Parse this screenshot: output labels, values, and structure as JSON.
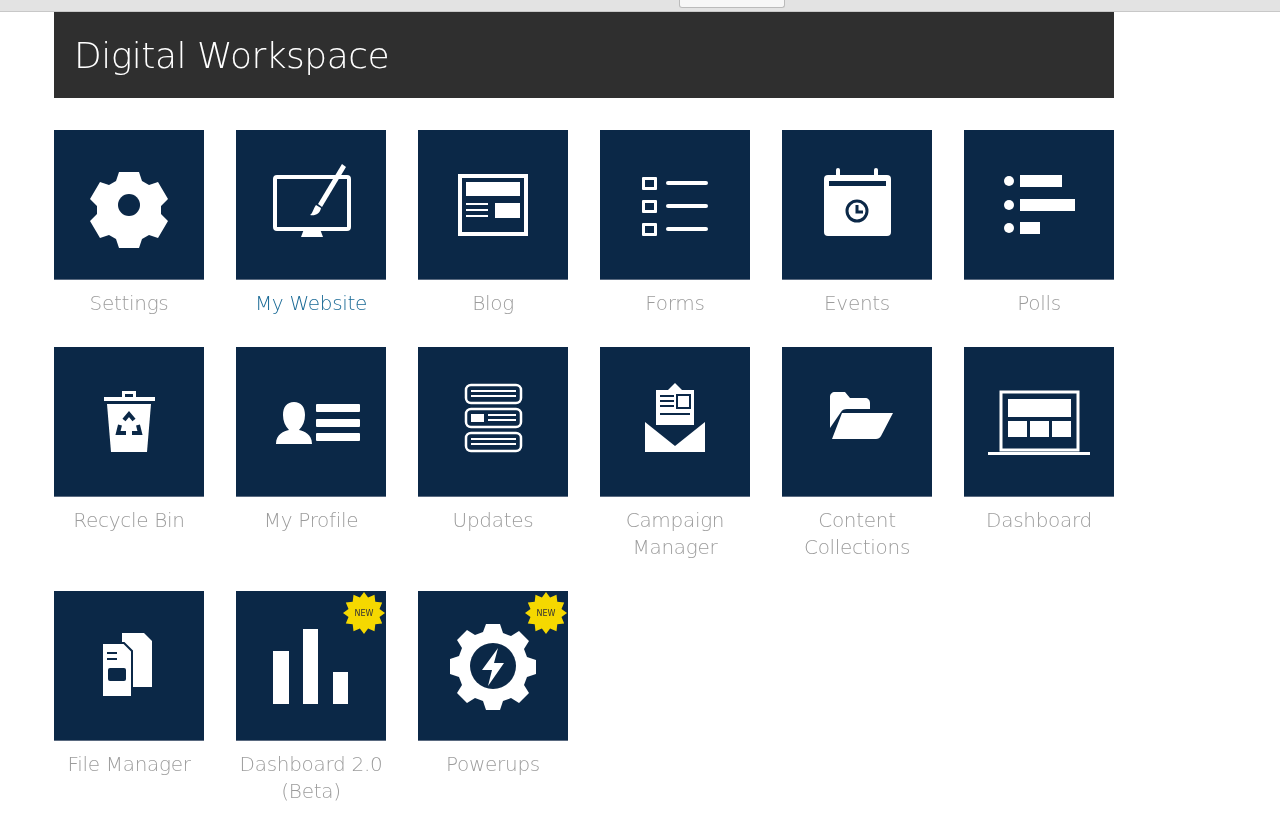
{
  "header": {
    "title": "Digital Workspace"
  },
  "tiles": [
    {
      "label": "Settings",
      "kind": "gear",
      "hovered": false
    },
    {
      "label": "My Website",
      "kind": "monitor",
      "hovered": true
    },
    {
      "label": "Blog",
      "kind": "blog",
      "hovered": false
    },
    {
      "label": "Forms",
      "kind": "checklist",
      "hovered": false
    },
    {
      "label": "Events",
      "kind": "calendar",
      "hovered": false
    },
    {
      "label": "Polls",
      "kind": "bullets",
      "hovered": false
    },
    {
      "label": "Recycle Bin",
      "kind": "recycle",
      "hovered": false
    },
    {
      "label": "My Profile",
      "kind": "profile",
      "hovered": false
    },
    {
      "label": "Updates",
      "kind": "stack",
      "hovered": false
    },
    {
      "label": "Campaign Manager",
      "kind": "envelope",
      "hovered": false
    },
    {
      "label": "Content Collections",
      "kind": "folder",
      "hovered": false
    },
    {
      "label": "Dashboard",
      "kind": "laptop",
      "hovered": false
    },
    {
      "label": "File Manager",
      "kind": "files",
      "hovered": false
    },
    {
      "label": "Dashboard 2.0 (Beta)",
      "kind": "bars",
      "hovered": false,
      "badge": "NEW"
    },
    {
      "label": "Powerups",
      "kind": "powerup",
      "hovered": false,
      "badge": "NEW"
    }
  ]
}
